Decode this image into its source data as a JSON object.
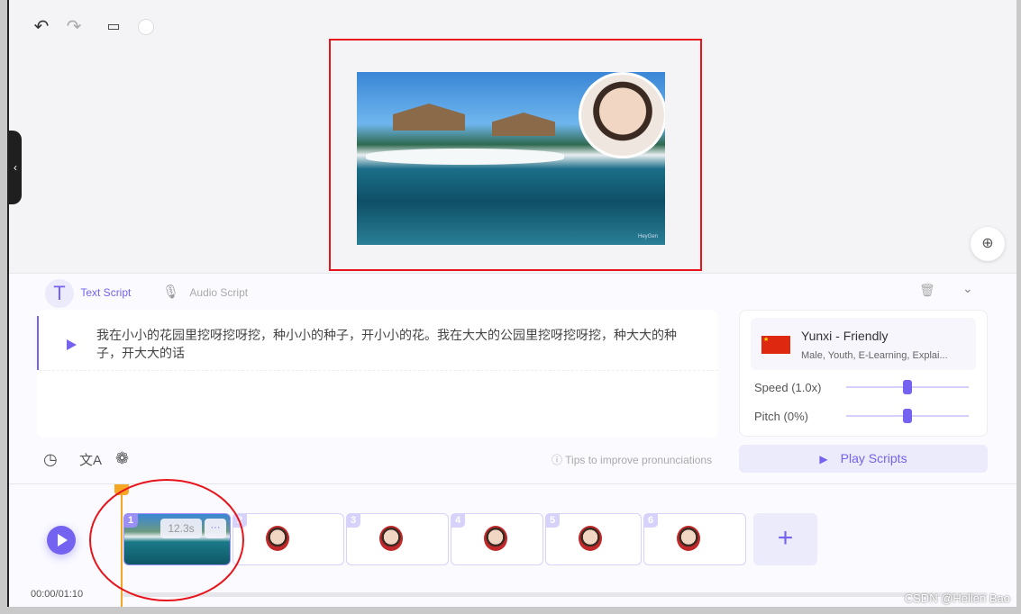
{
  "toolbar": {
    "icons": [
      "undo-icon",
      "redo-icon",
      "monitor-icon",
      "circle-icon"
    ]
  },
  "script_tabs": {
    "text": "Text Script",
    "audio": "Audio Script"
  },
  "script": {
    "text": "我在小小的花园里挖呀挖呀挖，种小小的种子，开小小的花。我在大大的公园里挖呀挖呀挖，种大大的种子，开大大的话"
  },
  "tips": "Tips to improve pronunciations",
  "voice": {
    "name": "Yunxi - Friendly",
    "tags": "Male, Youth, E-Learning, Explai...",
    "speed_label": "Speed (1.0x)",
    "pitch_label": "Pitch (0%)",
    "speed_value": 1.0,
    "pitch_value": 0,
    "speed_slider_fraction": 0.5,
    "pitch_slider_fraction": 0.5
  },
  "play_scripts": "Play Scripts",
  "timeline": {
    "time": "00:00/01:10",
    "clips": [
      {
        "n": "1",
        "duration": "12.3s",
        "more": "···"
      },
      {
        "n": "2"
      },
      {
        "n": "3"
      },
      {
        "n": "4"
      },
      {
        "n": "5"
      },
      {
        "n": "6"
      }
    ],
    "add": "+"
  },
  "preview": {
    "watermark": "HeyGen"
  },
  "watermark": "CSDN @Hellen Bao",
  "colors": {
    "accent": "#7463f0",
    "playhead": "#f5a623",
    "annotation": "#e8141c"
  }
}
